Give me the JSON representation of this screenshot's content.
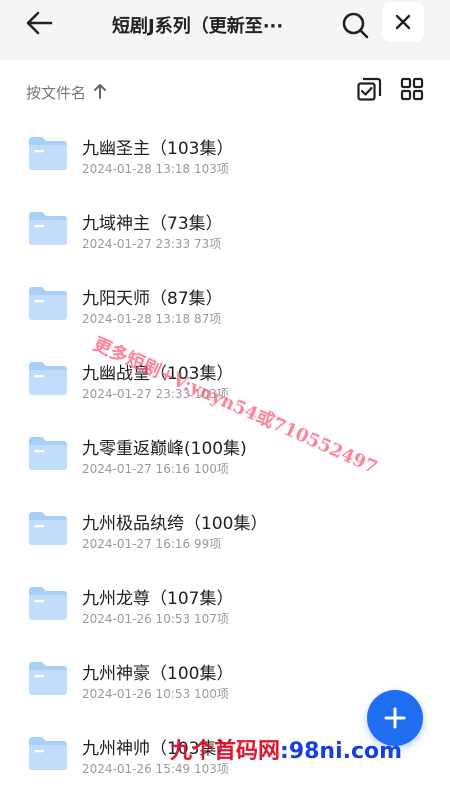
{
  "header": {
    "title": "短剧J系列（更新至···"
  },
  "toolbar": {
    "sort_label": "按文件名",
    "sort_direction_icon": "arrow-up-icon",
    "select_icon": "select-all-icon",
    "view_icon": "grid-view-icon"
  },
  "files": [
    {
      "name": "九幽圣主（103集）",
      "date": "2024-01-28 13:18",
      "count": "103项"
    },
    {
      "name": "九域神主（73集）",
      "date": "2024-01-27 23:33",
      "count": "73项"
    },
    {
      "name": "九阳天师（87集）",
      "date": "2024-01-28 13:18",
      "count": "87项"
    },
    {
      "name": "九幽战皇（103集）",
      "date": "2024-01-27 23:33",
      "count": "103项"
    },
    {
      "name": "九零重返巅峰(100集)",
      "date": "2024-01-27 16:16",
      "count": "100项"
    },
    {
      "name": "九州极品纨绔（100集）",
      "date": "2024-01-27 16:16",
      "count": "99项"
    },
    {
      "name": "九州龙尊（107集）",
      "date": "2024-01-26 10:53",
      "count": "107项"
    },
    {
      "name": "九州神豪（100集）",
      "date": "2024-01-26 10:53",
      "count": "100项"
    },
    {
      "name": "九州神帅（103集）",
      "date": "2024-01-26 15:49",
      "count": "103项"
    }
  ],
  "watermarks": {
    "diagonal": "更多短剧+V:ynyn54或710552497",
    "bottom_brand": "九个首码网",
    "bottom_domain": ":98ni.com"
  },
  "colors": {
    "accent": "#1f6ef2",
    "folder": "#a8cff8"
  }
}
